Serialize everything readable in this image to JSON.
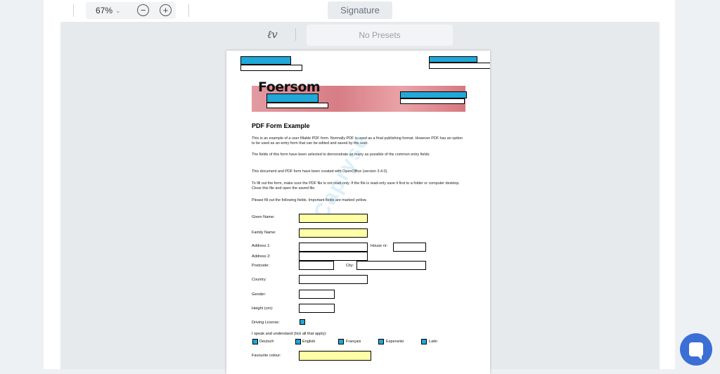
{
  "toolbar": {
    "zoom_value": "67%",
    "zoom_out_icon": "minus-circle-icon",
    "zoom_in_icon": "plus-circle-icon",
    "signature_tab": "Signature"
  },
  "signature_bar": {
    "signature_icon": "handwriting-icon",
    "presets_label": "No Presets"
  },
  "document": {
    "brand": "Foersom",
    "title": "PDF Form Example",
    "paragraphs": [
      "This is an example of a user fillable PDF form. Normally PDF is used as a final publishing format. However PDF has an option to be used as an entry form that can be edited and saved by the user.",
      "The fields of this form have been selected to demonstrate as many as possible of the common entry fields.",
      "This document and PDF form have been created with OpenOffice (version 3.4.0).",
      "To fill out the form, make sure the PDF file is not read-only. If the file is read-only save it first to a folder or computer desktop. Close this file and open the saved file.",
      "Please fill out the following fields. Important fields are marked yellow."
    ],
    "labels": {
      "given_name": "Given Name:",
      "family_name": "Family Name:",
      "address1": "Address 1:",
      "house_nr": "House nr:",
      "address2": "Address 2:",
      "postcode": "Postcode:",
      "city": "City:",
      "country": "Country:",
      "gender": "Gender:",
      "height": "Height (cm):",
      "driving_license": "Driving License:",
      "languages_prompt": "I speak and understand (tick all that apply):",
      "favourite_colour": "Favourite colour:"
    },
    "languages": [
      "Deutsch",
      "English",
      "Français",
      "Esperanto",
      "Latin"
    ],
    "watermark": "Capryse"
  },
  "colors": {
    "field_blue": "#1fa8d8",
    "field_yellow": "#ffffa6",
    "chat_button": "#3b6fd6"
  },
  "chat": {
    "icon": "chat-bubble-icon"
  }
}
